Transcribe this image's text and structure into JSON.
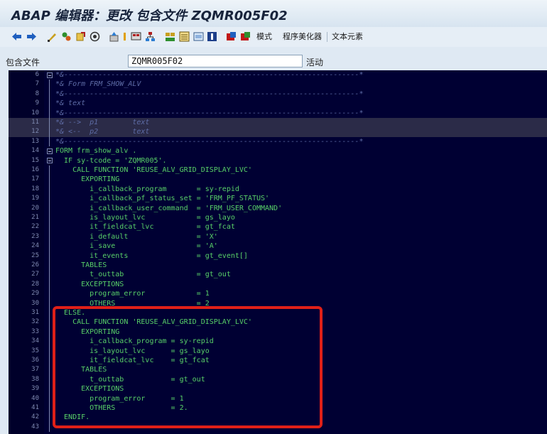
{
  "title": "ABAP 编辑器：更改 包含文件 ZQMR005F02",
  "toolbar": {
    "icons": [
      "back-arrow-icon",
      "forward-arrow-icon",
      "toggle-display-change-icon",
      "other-object-icon",
      "activate-icon",
      "check-icon",
      "test-icon",
      "where-used-icon",
      "display-object-list-icon",
      "hierarchy-icon",
      "navigation-window-icon",
      "pattern-icon",
      "pretty-printer-icon",
      "help-icon",
      "breakpoint-icon",
      "session-breakpoint-icon"
    ],
    "mode_label": "模式",
    "pretty_printer_label": "程序美化器",
    "text_elements_label": "文本元素"
  },
  "include_field": {
    "label": "包含文件",
    "value": "ZQMR005F02",
    "status": "活动"
  },
  "colors": {
    "editor_bg": "#000033",
    "code": "#58d068",
    "comment": "#5e6ca6",
    "highlight_box": "#e02018"
  },
  "lines": [
    {
      "num": "6",
      "text": "*&---------------------------------------------------------------------*"
    },
    {
      "num": "7",
      "text": "*& Form FRM_SHOW_ALV"
    },
    {
      "num": "8",
      "text": "*&---------------------------------------------------------------------*"
    },
    {
      "num": "9",
      "text": "*& text"
    },
    {
      "num": "10",
      "text": "*&---------------------------------------------------------------------*"
    },
    {
      "num": "11",
      "text": "*& -->  p1        text"
    },
    {
      "num": "12",
      "text": "*& <--  p2        text"
    },
    {
      "num": "13",
      "text": "*&---------------------------------------------------------------------*"
    },
    {
      "num": "14",
      "text": "FORM frm_show_alv ."
    },
    {
      "num": "15",
      "text": "  IF sy-tcode = 'ZQMR005'."
    },
    {
      "num": "16",
      "text": "    CALL FUNCTION 'REUSE_ALV_GRID_DISPLAY_LVC'"
    },
    {
      "num": "17",
      "text": "      EXPORTING"
    },
    {
      "num": "18",
      "text": "        i_callback_program       = sy-repid"
    },
    {
      "num": "19",
      "text": "        i_callback_pf_status_set = 'FRM_PF_STATUS'"
    },
    {
      "num": "20",
      "text": "        i_callback_user_command  = 'FRM_USER_COMMAND'"
    },
    {
      "num": "21",
      "text": "        is_layout_lvc            = gs_layo"
    },
    {
      "num": "22",
      "text": "        it_fieldcat_lvc          = gt_fcat"
    },
    {
      "num": "23",
      "text": "        i_default                = 'X'"
    },
    {
      "num": "24",
      "text": "        i_save                   = 'A'"
    },
    {
      "num": "25",
      "text": "        it_events                = gt_event[]"
    },
    {
      "num": "26",
      "text": "      TABLES"
    },
    {
      "num": "27",
      "text": "        t_outtab                 = gt_out"
    },
    {
      "num": "28",
      "text": "      EXCEPTIONS"
    },
    {
      "num": "29",
      "text": "        program_error            = 1"
    },
    {
      "num": "30",
      "text": "        OTHERS                   = 2"
    },
    {
      "num": "31",
      "text": "  ELSE."
    },
    {
      "num": "32",
      "text": "    CALL FUNCTION 'REUSE_ALV_GRID_DISPLAY_LVC'"
    },
    {
      "num": "33",
      "text": "      EXPORTING"
    },
    {
      "num": "34",
      "text": "        i_callback_program = sy-repid"
    },
    {
      "num": "35",
      "text": "        is_layout_lvc      = gs_layo"
    },
    {
      "num": "36",
      "text": "        it_fieldcat_lvc    = gt_fcat"
    },
    {
      "num": "37",
      "text": "      TABLES"
    },
    {
      "num": "38",
      "text": "        t_outtab           = gt_out"
    },
    {
      "num": "39",
      "text": "      EXCEPTIONS"
    },
    {
      "num": "40",
      "text": "        program_error      = 1"
    },
    {
      "num": "41",
      "text": "        OTHERS             = 2."
    },
    {
      "num": "42",
      "text": "  ENDIF."
    },
    {
      "num": "43",
      "text": ""
    }
  ]
}
